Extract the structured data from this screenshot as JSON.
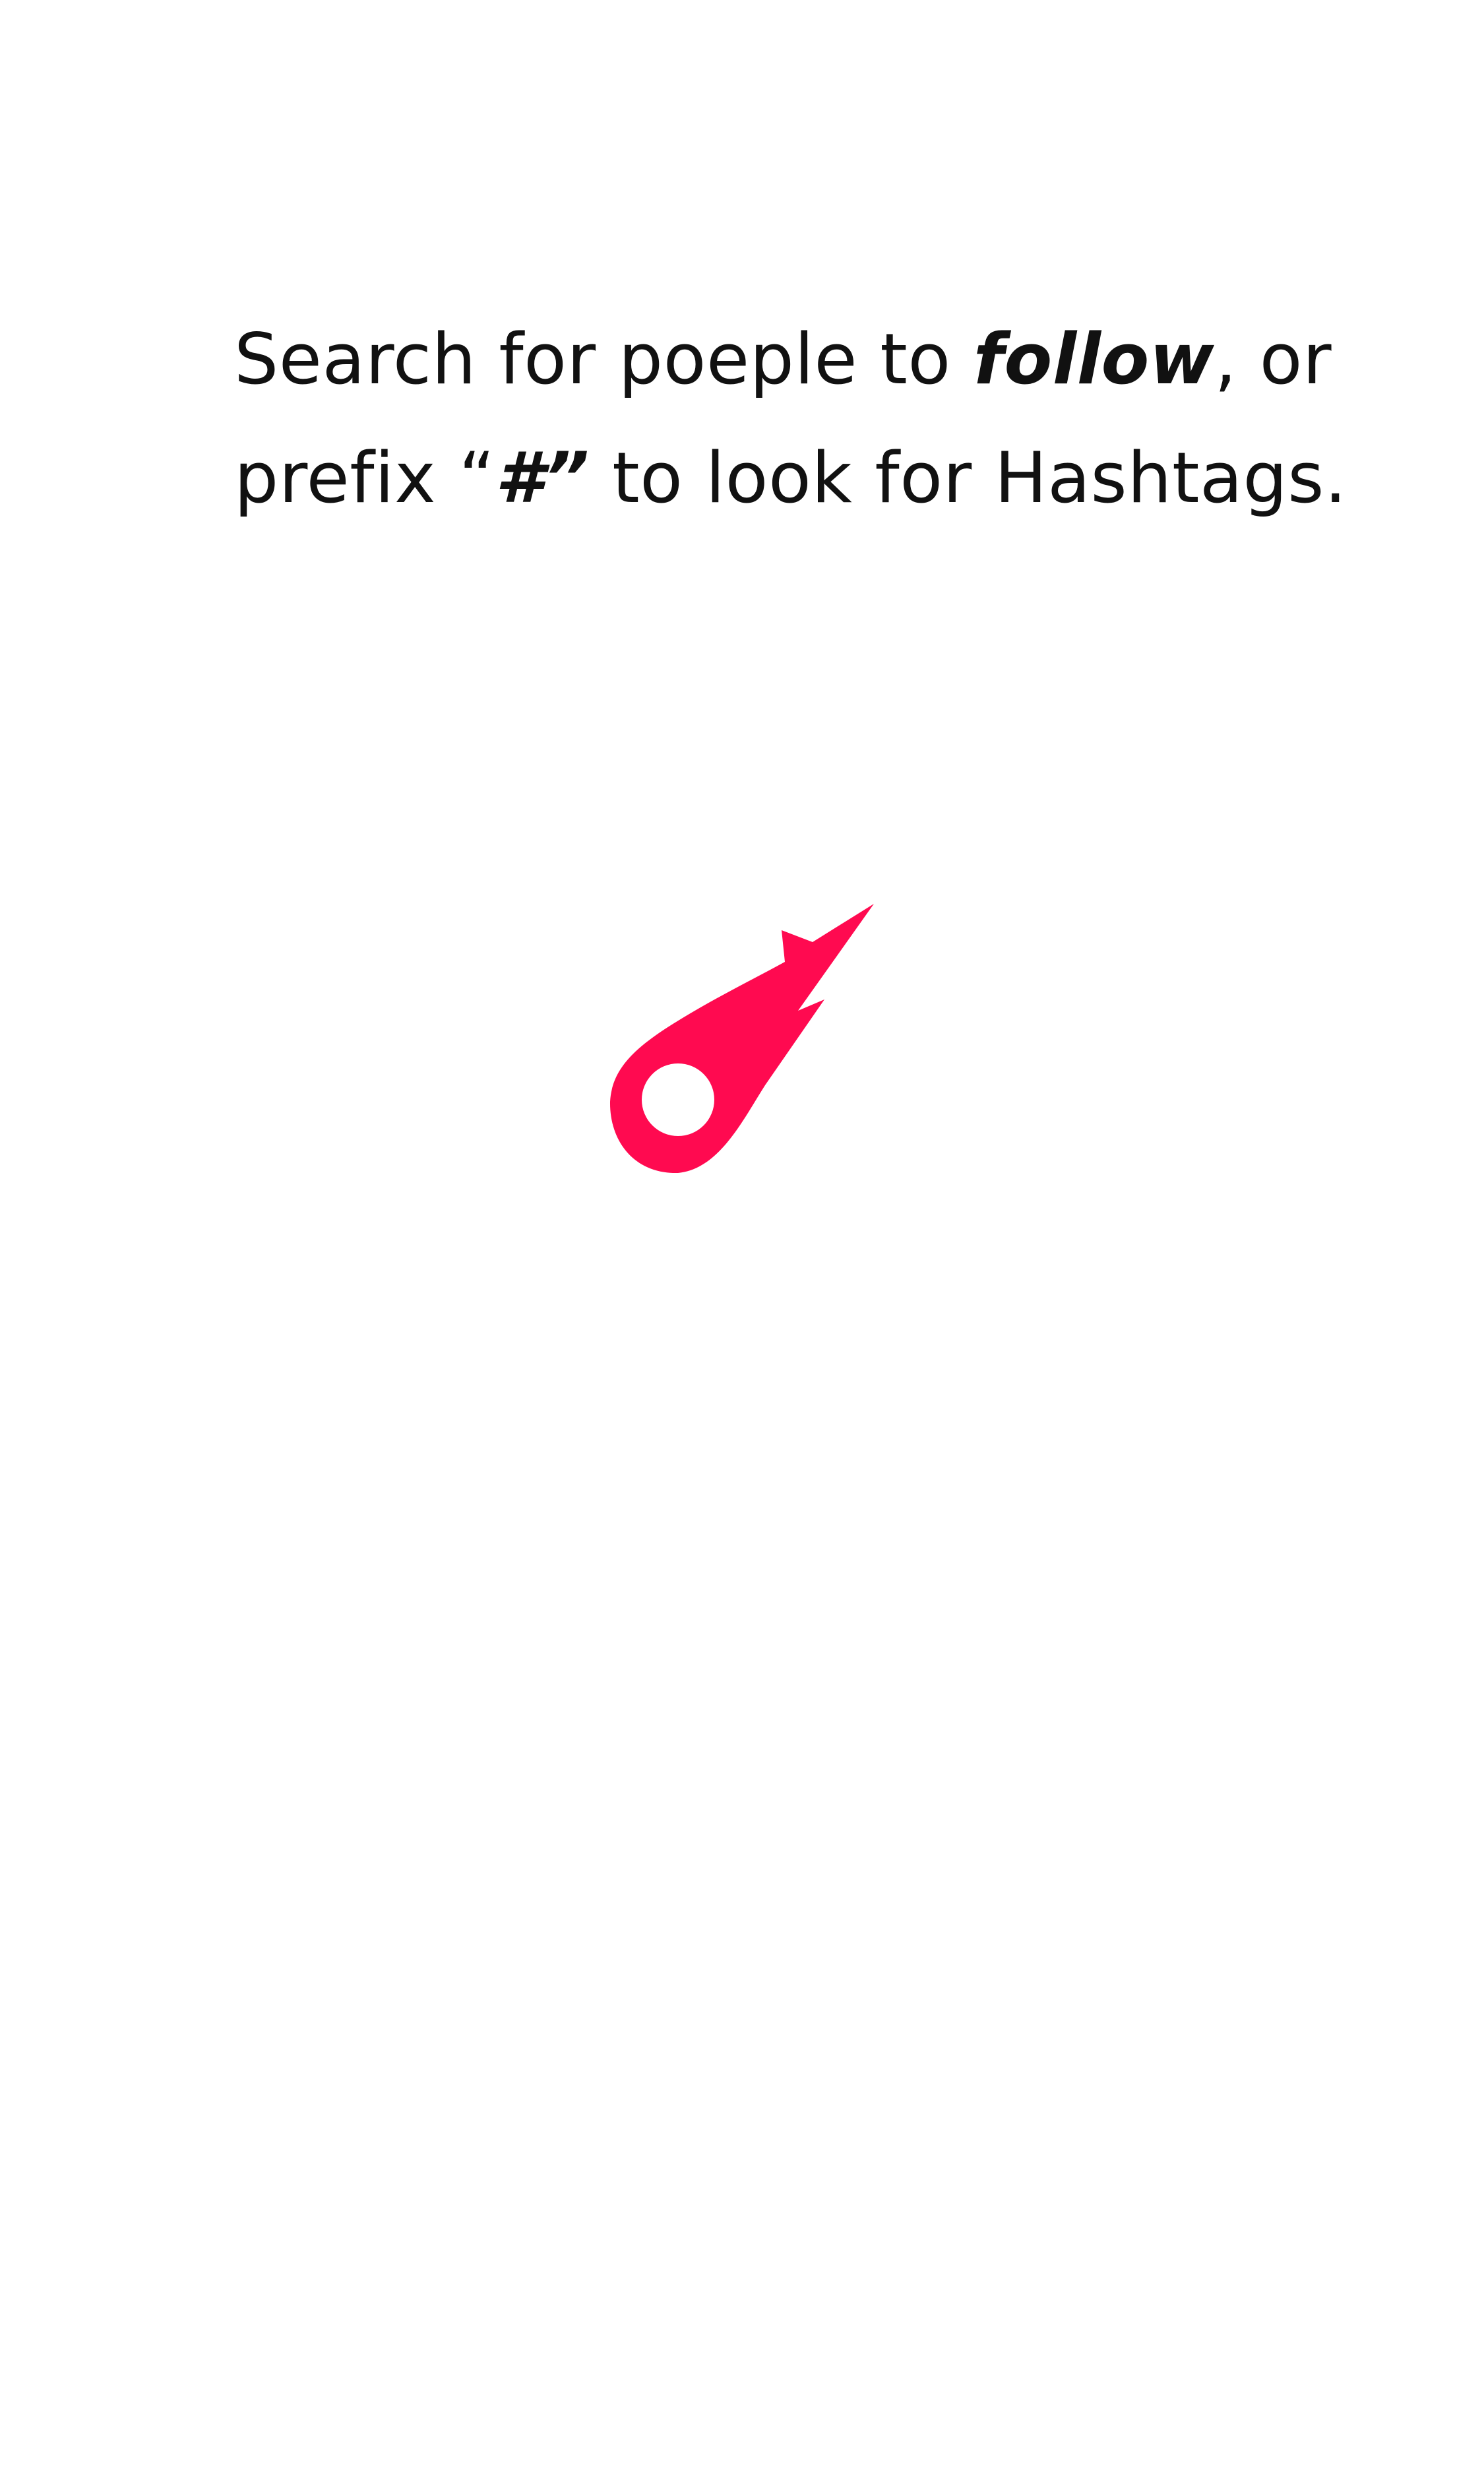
{
  "hint": {
    "line1_pre": "Search for poeple to ",
    "line1_emphasis": "follow",
    "line1_post": ", or",
    "line2_pre": "prefix “",
    "line2_emphasis": "#”",
    "line2_post": " to look for Hashtags."
  },
  "logo": {
    "icon": "comet-icon",
    "color": "#ff0a50"
  }
}
